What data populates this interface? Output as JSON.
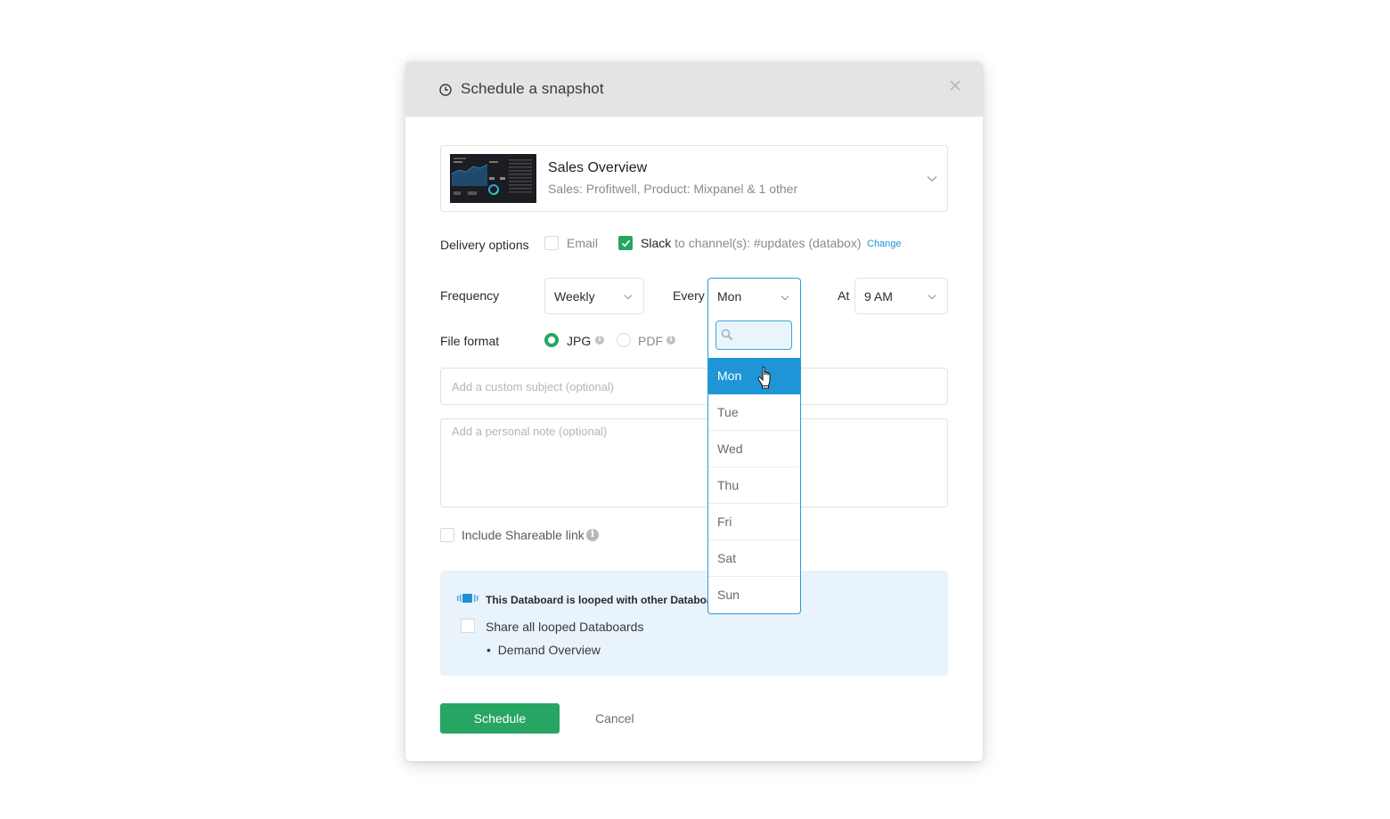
{
  "modal": {
    "title": "Schedule a snapshot",
    "header_icon": "clock-icon",
    "close_icon": "close-icon"
  },
  "databoard": {
    "name": "Sales Overview",
    "sources": "Sales: Profitwell, Product: Mixpanel & 1 other",
    "thumbnail": "dashboard-thumbnail"
  },
  "delivery": {
    "label": "Delivery options",
    "email": {
      "label": "Email",
      "checked": false
    },
    "slack": {
      "label": "Slack",
      "detail": " to channel(s): #updates (databox)",
      "checked": true
    },
    "change_link": "Change"
  },
  "frequency": {
    "label": "Frequency",
    "value": "Weekly",
    "every_label": "Every",
    "every_value": "Mon",
    "at_label": "At",
    "at_value": "9 AM"
  },
  "file_format": {
    "label": "File format",
    "options": [
      {
        "label": "JPG",
        "selected": true
      },
      {
        "label": "PDF",
        "selected": false
      }
    ]
  },
  "subject_input": {
    "placeholder": "Add a custom subject (optional)",
    "value": ""
  },
  "note_input": {
    "placeholder": "Add a personal note (optional)",
    "value": ""
  },
  "shareable_link": {
    "label": "Include Shareable link",
    "checked": false
  },
  "loop": {
    "title": "This Databoard is looped with other Databoards",
    "share_label": "Share all looped Databoards",
    "share_checked": false,
    "databoards": [
      "Demand Overview"
    ]
  },
  "actions": {
    "schedule": "Schedule",
    "cancel": "Cancel"
  },
  "day_dropdown": {
    "open": true,
    "search_value": "",
    "highlighted": "Mon",
    "options": [
      "Mon",
      "Tue",
      "Wed",
      "Thu",
      "Fri",
      "Sat",
      "Sun"
    ]
  },
  "colors": {
    "accent_green": "#27a562",
    "accent_blue": "#1e95d6",
    "header_bg": "#e3e4e6",
    "loop_bg": "#e8f3fb"
  }
}
